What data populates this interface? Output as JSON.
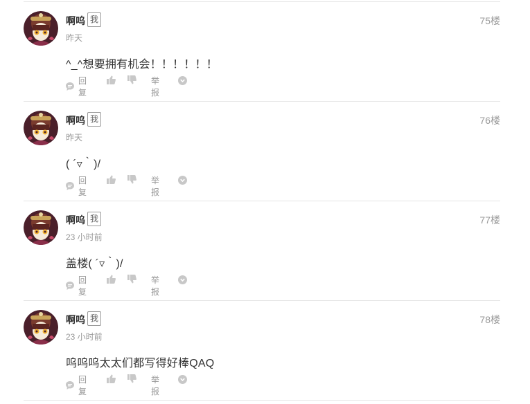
{
  "comments": [
    {
      "name": "啊呜",
      "badge": "我",
      "time": "昨天",
      "floor": "75楼",
      "content": "^_^想要拥有机会！！！！！！",
      "reply_label": "回复",
      "report_label": "举报"
    },
    {
      "name": "啊呜",
      "badge": "我",
      "time": "昨天",
      "floor": "76楼",
      "content": "( ´▿｀)/",
      "reply_label": "回复",
      "report_label": "举报"
    },
    {
      "name": "啊呜",
      "badge": "我",
      "time": "23 小时前",
      "floor": "77楼",
      "content": "盖楼( ´▿｀)/",
      "reply_label": "回复",
      "report_label": "举报"
    },
    {
      "name": "啊呜",
      "badge": "我",
      "time": "23 小时前",
      "floor": "78楼",
      "content": "呜呜呜太太们都写得好棒QAQ",
      "reply_label": "回复",
      "report_label": "举报"
    }
  ],
  "colors": {
    "text": "#333333",
    "muted": "#999999",
    "icon": "#c8c8c8",
    "divider": "#e5e5e5"
  },
  "icons": {
    "reply": "speech-bubble-icon",
    "like": "thumbs-up-icon",
    "dislike": "thumbs-down-icon",
    "more": "chevron-down-icon"
  }
}
